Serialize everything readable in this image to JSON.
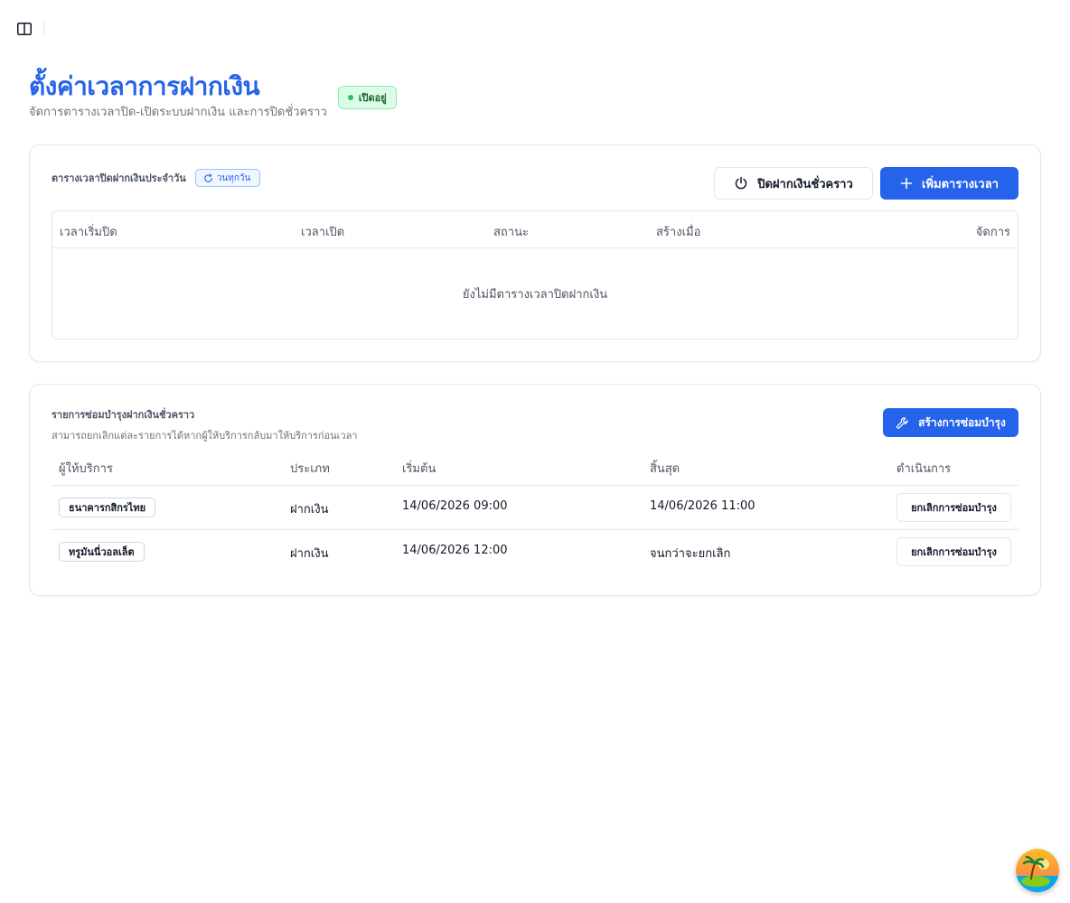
{
  "header": {
    "title": "ตั้งค่าเวลาการฝากเงิน",
    "subtitle": "จัดการตารางเวลาปิด-เปิดระบบฝากเงิน และการปิดชั่วคราว",
    "status_label": "เปิดอยู่"
  },
  "schedule": {
    "title": "ตารางเวลาปิดฝากเงินประจำวัน",
    "daily_badge": "วนทุกวัน",
    "pause_button": "ปิดฝากเงินชั่วคราว",
    "add_button": "เพิ่มตารางเวลา",
    "columns": [
      "เวลาเริ่มปิด",
      "เวลาเปิด",
      "สถานะ",
      "สร้างเมื่อ",
      "จัดการ"
    ],
    "empty_text": "ยังไม่มีตารางเวลาปิดฝากเงิน"
  },
  "maintenance": {
    "title": "รายการซ่อมบำรุงฝากเงินชั่วคราว",
    "subtitle": "สามารถยกเลิกแต่ละรายการได้หากผู้ให้บริการกลับมาให้บริการก่อนเวลา",
    "create_button": "สร้างการซ่อมบำรุง",
    "columns": [
      "ผู้ให้บริการ",
      "ประเภท",
      "เริ่มต้น",
      "สิ้นสุด",
      "ดำเนินการ"
    ],
    "rows": [
      {
        "provider": "ธนาคารกสิกรไทย",
        "type": "ฝากเงิน",
        "start": "14/06/2026 09:00",
        "end": "14/06/2026 11:00",
        "action": "ยกเลิกการซ่อมบำรุง"
      },
      {
        "provider": "ทรูมันนี่วอลเล็ต",
        "type": "ฝากเงิน",
        "start": "14/06/2026 12:00",
        "end": "จนกว่าจะยกเลิก",
        "action": "ยกเลิกการซ่อมบำรุง"
      }
    ]
  },
  "colors": {
    "primary": "#2563eb",
    "status_bg": "#dcfce7",
    "status_text": "#166534"
  },
  "icons": [
    "sidebar-toggle-icon",
    "refresh-icon",
    "power-icon",
    "plus-icon",
    "wrench-icon",
    "avatar-palm-icon"
  ]
}
